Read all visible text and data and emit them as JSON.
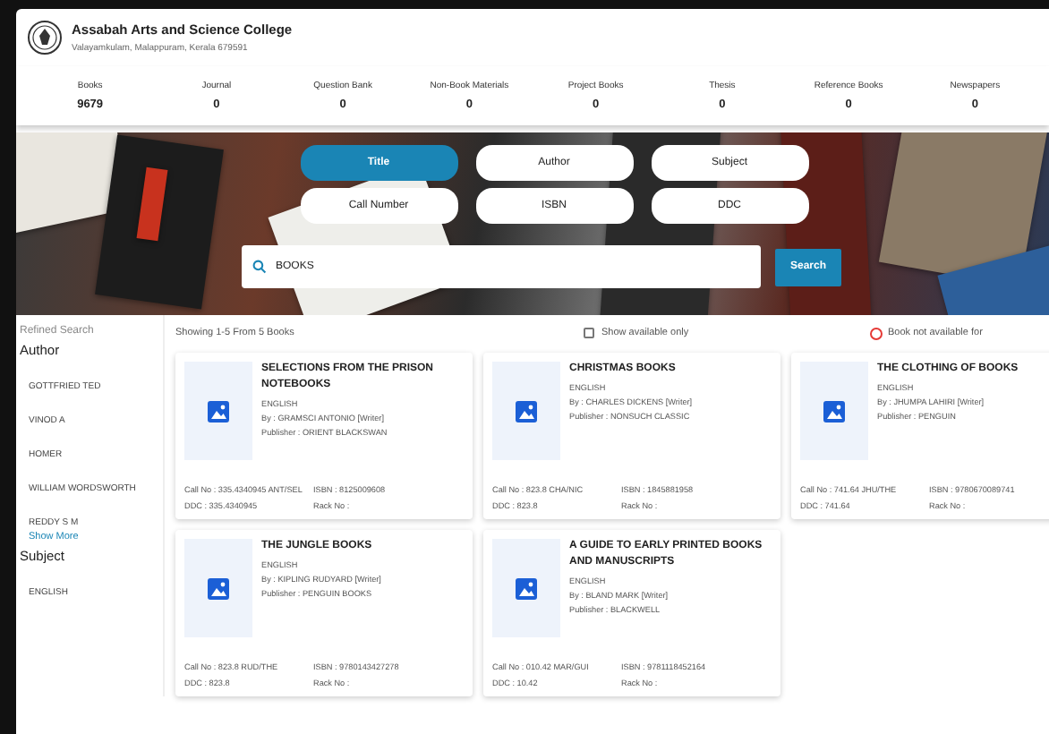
{
  "college": {
    "name": "Assabah Arts and Science College",
    "address": "Valayamkulam, Malappuram, Kerala 679591"
  },
  "stats": [
    {
      "label": "Books",
      "value": "9679"
    },
    {
      "label": "Journal",
      "value": "0"
    },
    {
      "label": "Question Bank",
      "value": "0"
    },
    {
      "label": "Non-Book Materials",
      "value": "0"
    },
    {
      "label": "Project Books",
      "value": "0"
    },
    {
      "label": "Thesis",
      "value": "0"
    },
    {
      "label": "Reference Books",
      "value": "0"
    },
    {
      "label": "Newspapers",
      "value": "0"
    }
  ],
  "search_types": [
    {
      "label": "Title",
      "selected": true
    },
    {
      "label": "Author",
      "selected": false
    },
    {
      "label": "Subject",
      "selected": false
    },
    {
      "label": "Call Number",
      "selected": false
    },
    {
      "label": "ISBN",
      "selected": false
    },
    {
      "label": "DDC",
      "selected": false
    }
  ],
  "search": {
    "value": "BOOKS",
    "button": "Search"
  },
  "sidebar": {
    "heading": "Refined Search",
    "groups": [
      {
        "title": "Author",
        "items": [
          "GOTTFRIED TED",
          "VINOD A",
          "HOMER",
          "WILLIAM WORDSWORTH",
          "REDDY S M"
        ],
        "more": "Show More"
      },
      {
        "title": "Subject",
        "items": [
          "ENGLISH"
        ]
      }
    ]
  },
  "results": {
    "summary": "Showing 1-5 From 5 Books",
    "available_only": {
      "label": "Show available only",
      "checked": false
    },
    "legend": "Book not available for",
    "books": [
      {
        "title": "SELECTIONS FROM THE PRISON NOTEBOOKS",
        "language": "ENGLISH",
        "by": "By : GRAMSCI ANTONIO [Writer]",
        "publisher": "Publisher : ORIENT BLACKSWAN",
        "call_no": "Call No : 335.4340945 ANT/SEL",
        "isbn": "ISBN : 8125009608",
        "ddc": "DDC : 335.4340945",
        "rack": "Rack No :"
      },
      {
        "title": "CHRISTMAS BOOKS",
        "language": "ENGLISH",
        "by": "By : CHARLES DICKENS [Writer]",
        "publisher": "Publisher : NONSUCH CLASSIC",
        "call_no": "Call No : 823.8 CHA/NIC",
        "isbn": "ISBN : 1845881958",
        "ddc": "DDC : 823.8",
        "rack": "Rack No :"
      },
      {
        "title": "THE CLOTHING OF BOOKS",
        "language": "ENGLISH",
        "by": "By : JHUMPA LAHIRI [Writer]",
        "publisher": "Publisher : PENGUIN",
        "call_no": "Call No : 741.64 JHU/THE",
        "isbn": "ISBN : 9780670089741",
        "ddc": "DDC : 741.64",
        "rack": "Rack No :"
      },
      {
        "title": "THE JUNGLE BOOKS",
        "language": "ENGLISH",
        "by": "By : KIPLING RUDYARD [Writer]",
        "publisher": "Publisher : PENGUIN BOOKS",
        "call_no": "Call No : 823.8 RUD/THE",
        "isbn": "ISBN : 9780143427278",
        "ddc": "DDC : 823.8",
        "rack": "Rack No :"
      },
      {
        "title": "A GUIDE TO EARLY PRINTED BOOKS AND MANUSCRIPTS",
        "language": "ENGLISH",
        "by": "By : BLAND MARK [Writer]",
        "publisher": "Publisher : BLACKWELL",
        "call_no": "Call No : 010.42 MAR/GUI",
        "isbn": "ISBN : 9781118452164",
        "ddc": "DDC : 10.42",
        "rack": "Rack No :"
      }
    ]
  }
}
